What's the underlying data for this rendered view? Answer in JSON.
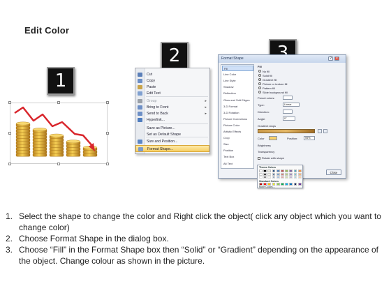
{
  "slide": {
    "title": "Edit Color"
  },
  "badges": [
    "1",
    "2",
    "3"
  ],
  "context_menu": {
    "items": [
      {
        "label": "Cut",
        "icon": "scissors-icon",
        "disabled": false,
        "submenu": false
      },
      {
        "label": "Copy",
        "icon": "copy-icon",
        "disabled": false,
        "submenu": false
      },
      {
        "label": "Paste",
        "icon": "paste-icon",
        "disabled": false,
        "submenu": false
      },
      {
        "label": "Edit Text",
        "icon": "edit-text-icon",
        "disabled": false,
        "submenu": false
      },
      {
        "label": "Group",
        "icon": "group-icon",
        "disabled": true,
        "submenu": true
      },
      {
        "label": "Bring to Front",
        "icon": "bring-front-icon",
        "disabled": false,
        "submenu": true
      },
      {
        "label": "Send to Back",
        "icon": "send-back-icon",
        "disabled": false,
        "submenu": true
      },
      {
        "label": "Hyperlink...",
        "icon": "hyperlink-icon",
        "disabled": false,
        "submenu": false
      },
      {
        "label": "Save as Picture...",
        "icon": "",
        "disabled": false,
        "submenu": false
      },
      {
        "label": "Set as Default Shape",
        "icon": "",
        "disabled": false,
        "submenu": false
      },
      {
        "label": "Size and Position...",
        "icon": "size-position-icon",
        "disabled": false,
        "submenu": false
      },
      {
        "label": "Format Shape...",
        "icon": "format-shape-icon",
        "disabled": false,
        "submenu": false,
        "highlighted": true
      }
    ]
  },
  "format_dialog": {
    "title": "Format Shape",
    "categories": [
      "Fill",
      "Line Color",
      "Line Style",
      "Shadow",
      "Reflection",
      "Glow and Soft Edges",
      "3-D Format",
      "3-D Rotation",
      "Picture Corrections",
      "Picture Color",
      "Artistic Effects",
      "Crop",
      "Size",
      "Position",
      "Text Box",
      "Alt Text"
    ],
    "selected_category": "Fill",
    "section_title": "Fill",
    "fill_options": [
      "No fill",
      "Solid fill",
      "Gradient fill",
      "Picture or texture fill",
      "Pattern fill",
      "Slide background fill"
    ],
    "selected_fill": "Gradient fill",
    "labels": {
      "preset_colors": "Preset colors:",
      "type": "Type:",
      "type_value": "Linear",
      "direction": "Direction:",
      "angle": "Angle:",
      "angle_value": "0°",
      "gradient_stops": "Gradient stops",
      "color": "Color",
      "position": "Position:",
      "position_value": "99%",
      "brightness": "Brightness",
      "transparency": "Transparency",
      "rotate": "Rotate with shape",
      "close": "Close"
    }
  },
  "color_palette": {
    "theme_heading": "Theme Colors",
    "standard_heading": "Standard Colors",
    "more_colors": "More Colors...",
    "theme_colors": [
      "#ffffff",
      "#000000",
      "#eeece1",
      "#1f497d",
      "#4f81bd",
      "#c0504d",
      "#9bbb59",
      "#8064a2",
      "#4bacc6",
      "#f79646"
    ],
    "standard_colors": [
      "#c00000",
      "#ff0000",
      "#ffc000",
      "#ffff00",
      "#92d050",
      "#00b050",
      "#00b0f0",
      "#0070c0",
      "#002060",
      "#7030a0"
    ]
  },
  "chart_colors": {
    "arrow": "#d9262c",
    "coin": "#e6b02e",
    "coin_edge": "#a9761a"
  },
  "instructions": [
    {
      "num": "1.",
      "text": "Select the shape to change the color and Right click the object( click any object which you want to change color)"
    },
    {
      "num": "2.",
      "text": "Choose Format Shape in the dialog box."
    },
    {
      "num": "3.",
      "text": "Choose “Fill” in the Format Shape box then “Solid” or “Gradient” depending on the appearance of the object. Change colour as shown in the picture."
    }
  ]
}
